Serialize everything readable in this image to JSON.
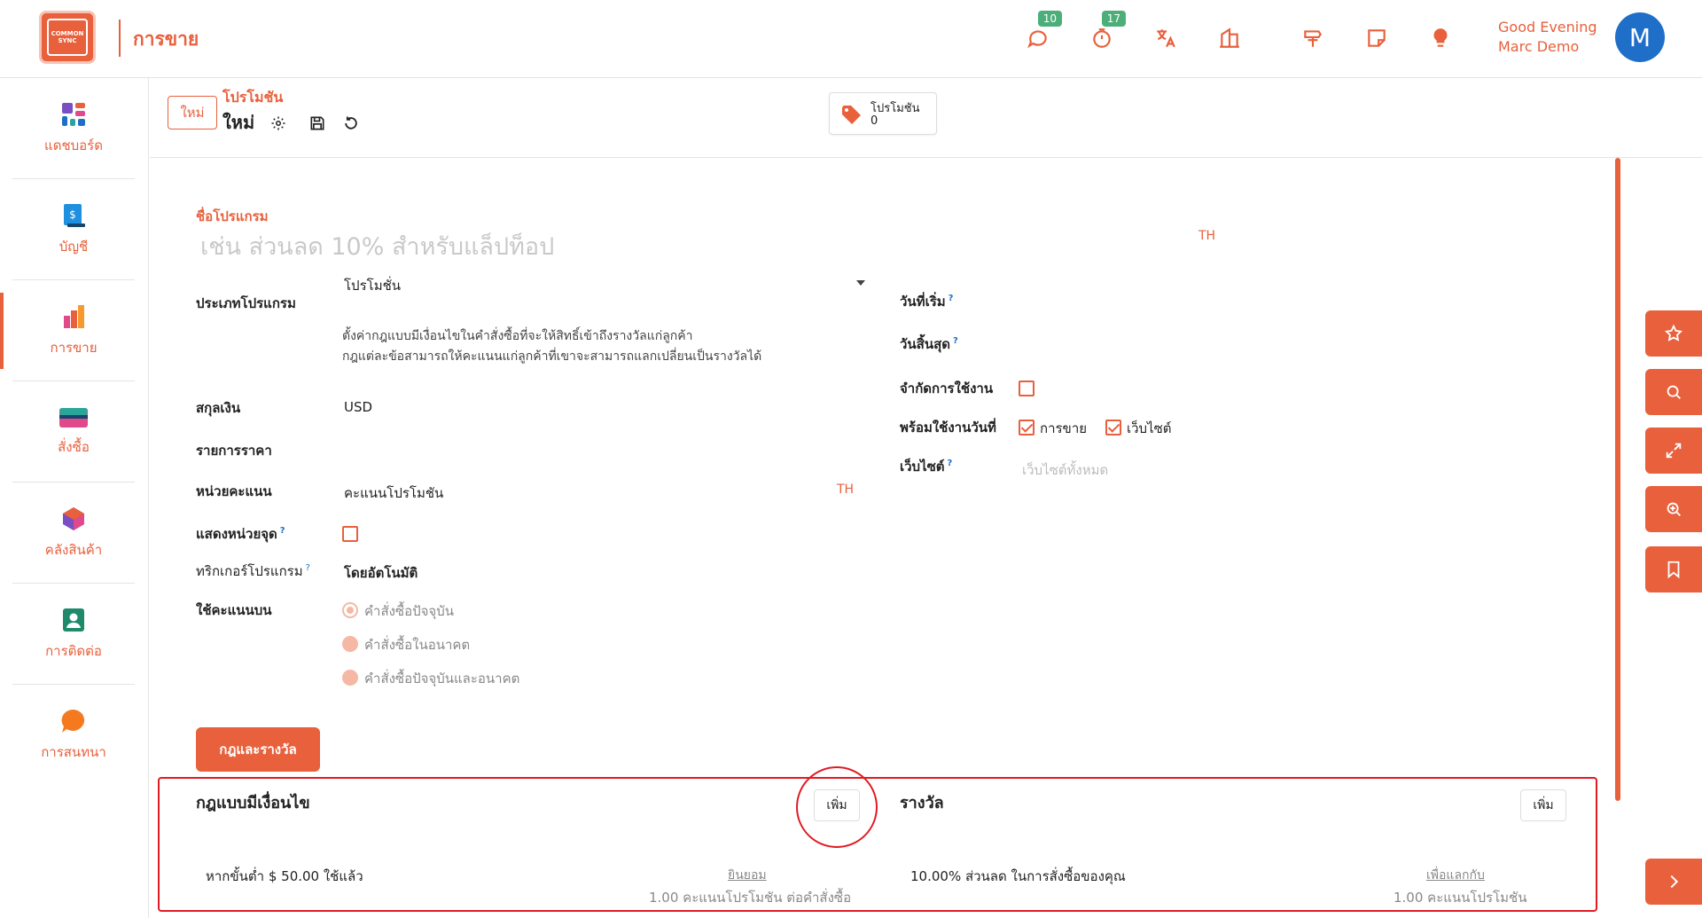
{
  "brand": {
    "logo_text": "COMMON SYNC",
    "app_title": "การขาย",
    "accent": "#e8603c"
  },
  "topbar": {
    "chat_badge": "10",
    "timer_badge": "17",
    "greeting_line1": "Good Evening",
    "greeting_line2": "Marc Demo",
    "avatar_initial": "M",
    "icons": [
      "chat-icon",
      "timer-icon",
      "translate-icon",
      "building-icon",
      "signpost-icon",
      "note-icon",
      "lightbulb-icon"
    ]
  },
  "sidebar": {
    "items": [
      {
        "label": "แดชบอร์ด",
        "icon": "dashboard-icon"
      },
      {
        "label": "บัญชี",
        "icon": "accounting-icon"
      },
      {
        "label": "การขาย",
        "icon": "sales-icon"
      },
      {
        "label": "สั่งซื้อ",
        "icon": "purchase-icon"
      },
      {
        "label": "คลังสินค้า",
        "icon": "inventory-icon"
      },
      {
        "label": "การติดต่อ",
        "icon": "contacts-icon"
      },
      {
        "label": "การสนทนา",
        "icon": "discuss-icon"
      }
    ]
  },
  "control": {
    "new_button": "ใหม่",
    "breadcrumb_parent": "โปรโมชัน",
    "breadcrumb_current": "ใหม่",
    "smart_button_title": "โปรโมชัน",
    "smart_button_count": "0"
  },
  "form": {
    "program_name_label": "ชื่อโปรแกรม",
    "program_name_placeholder": "เช่น ส่วนลด 10% สำหรับแล็ปท็อป",
    "lang_code": "TH",
    "program_type_label": "ประเภทโปรแกรม",
    "program_type_value": "โปรโมชั่น",
    "program_type_help_1": "ตั้งค่ากฎแบบมีเงื่อนไขในคำสั่งซื้อที่จะให้สิทธิ์เข้าถึงรางวัลแก่ลูกค้า",
    "program_type_help_2": "กฎแต่ละข้อสามารถให้คะแนนแก่ลูกค้าที่เขาจะสามารถแลกเปลี่ยนเป็นรางวัลได้",
    "currency_label": "สกุลเงิน",
    "currency_value": "USD",
    "pricelist_label": "รายการราคา",
    "points_unit_label": "หน่วยคะแนน",
    "points_unit_value": "คะแนนโปรโมชัน",
    "show_points_label": "แสดงหน่วยจุด",
    "trigger_label": "ทริกเกอร์โปรแกรม",
    "trigger_value": "โดยอัตโนมัติ",
    "apply_on_label": "ใช้คะแนนบน",
    "apply_on_options": [
      "คำสั่งซื้อปัจจุบัน",
      "คำสั่งซื้อในอนาคต",
      "คำสั่งซื้อปัจจุบันและอนาคต"
    ],
    "start_date_label": "วันที่เริ่ม",
    "end_date_label": "วันสิ้นสุด",
    "limit_usage_label": "จำกัดการใช้งาน",
    "available_on_label": "พร้อมใช้งานวันที่",
    "available_sales": "การขาย",
    "available_website": "เว็บไซต์",
    "website_label": "เว็บไซต์",
    "website_placeholder": "เว็บไซต์ทั้งหมด"
  },
  "tabs": {
    "rules_rewards": "กฎและรางวัล"
  },
  "rules": {
    "title": "กฎแบบมีเงื่อนไข",
    "add_label": "เพิ่ม",
    "row_condition": "หากขั้นต่ำ $ 50.00 ใช้แล้ว",
    "row_link": "ยินยอม",
    "row_sub": "1.00 คะแนนโปรโมชัน ต่อคำสั่งซื้อ"
  },
  "rewards": {
    "title": "รางวัล",
    "add_label": "เพิ่ม",
    "row_reward": "10.00% ส่วนลด ในการสั่งซื้อของคุณ",
    "row_link": "เพื่อแลกกับ",
    "row_sub": "1.00 คะแนนโปรโมชัน"
  },
  "float_buttons": [
    "star-icon",
    "search-icon",
    "expand-icon",
    "zoom-in-icon",
    "bookmark-icon",
    "chevron-right-icon"
  ]
}
